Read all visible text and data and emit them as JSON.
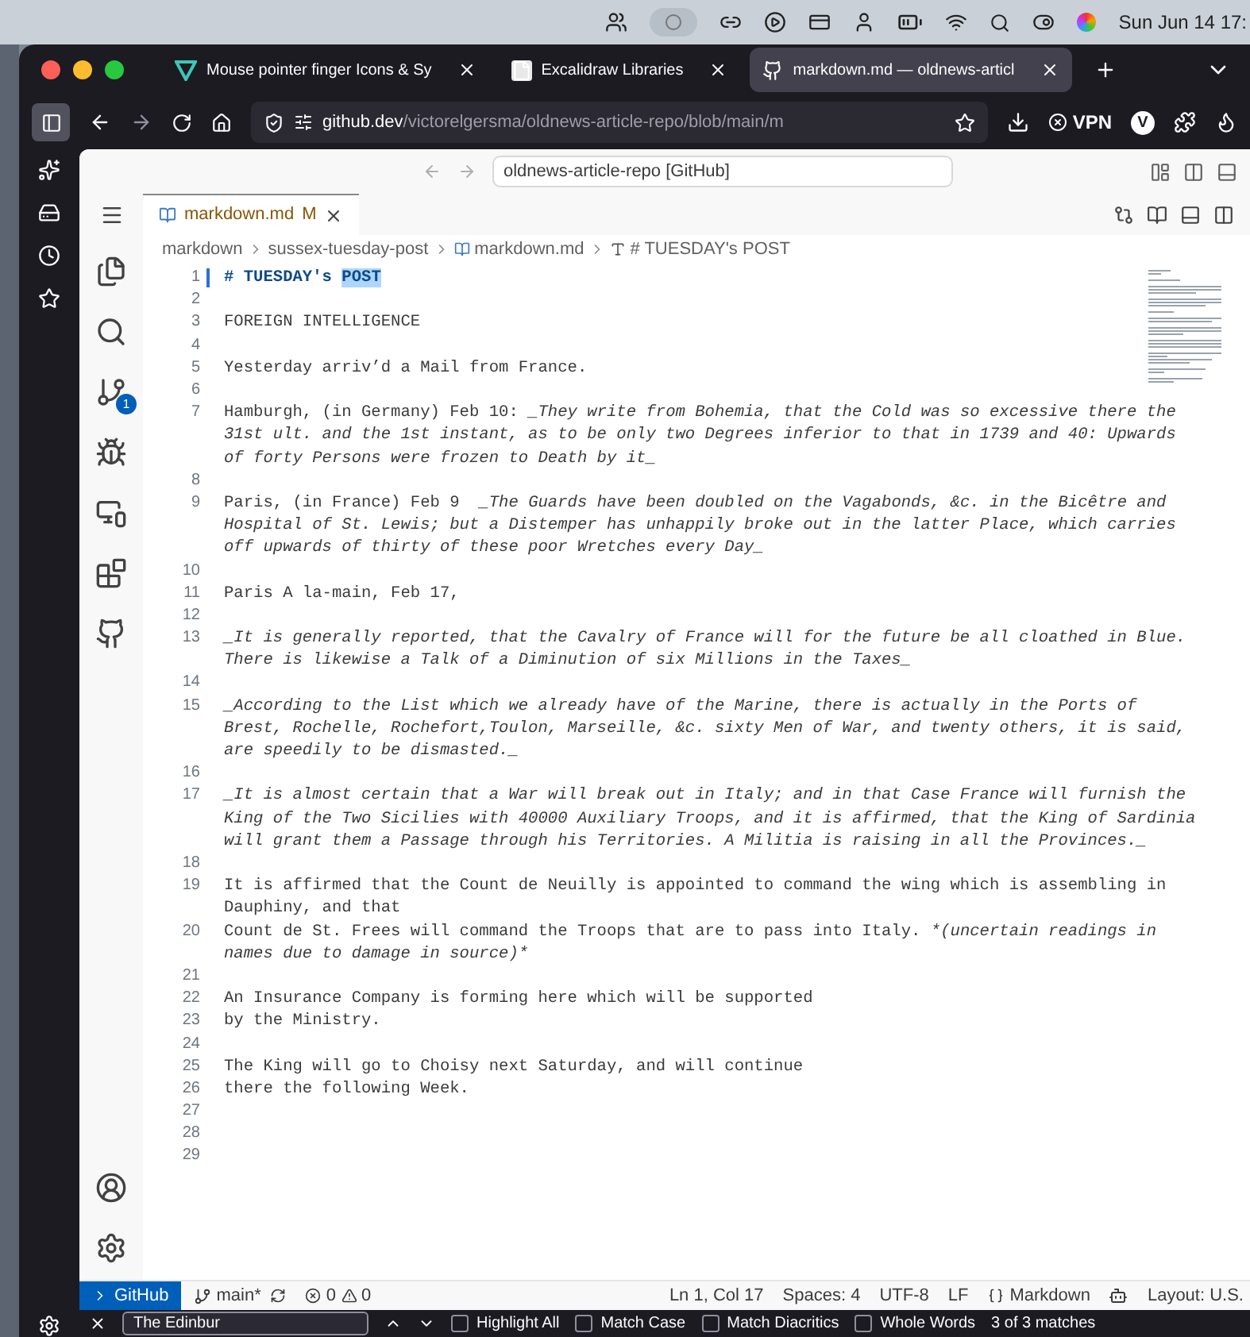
{
  "menu_bar": {
    "clock": "Sun Jun 14 17:"
  },
  "browser": {
    "tabs": [
      {
        "title": "Mouse pointer finger Icons & Sy",
        "selected": false,
        "kind": "vector"
      },
      {
        "title": "Excalidraw Libraries",
        "selected": false,
        "kind": "page"
      },
      {
        "title": "markdown.md — oldnews-articl",
        "selected": true,
        "kind": "github"
      }
    ],
    "url": {
      "host": "github.dev",
      "path": "/victorelgersma/oldnews-article-repo/blob/main/m"
    },
    "vpn": "VPN",
    "profile": "V"
  },
  "editor": {
    "command_center": "oldnews-article-repo [GitHub]",
    "source_control_badge": "1",
    "tab": {
      "name": "markdown.md",
      "status": "M",
      "selected": true
    },
    "breadcrumbs": [
      {
        "text": "markdown",
        "kind": "folder"
      },
      {
        "text": "sussex-tuesday-post",
        "kind": "folder"
      },
      {
        "text": "markdown.md",
        "kind": "file"
      },
      {
        "text": "# TUESDAY's POST",
        "kind": "symbol"
      }
    ],
    "lines": [
      {
        "number": "1",
        "changed": true,
        "rows": [
          [
            {
              "text": "# TUESDAY's ",
              "kind": "heading"
            },
            {
              "text": "POST",
              "kind": "heading-selected"
            }
          ]
        ]
      },
      {
        "number": "2",
        "changed": false
      },
      {
        "number": "3",
        "changed": false,
        "rows": [
          [
            {
              "text": "FOREIGN INTELLIGENCE",
              "kind": "plain"
            }
          ]
        ]
      },
      {
        "number": "4",
        "changed": false
      },
      {
        "number": "5",
        "changed": false,
        "rows": [
          [
            {
              "text": "Yesterday arriv’d a Mail from France.",
              "kind": "plain"
            }
          ]
        ]
      },
      {
        "number": "6",
        "changed": false
      },
      {
        "number": "7",
        "changed": false,
        "rows": [
          [
            {
              "text": "Hamburgh, (in Germany) Feb 10: ",
              "kind": "plain"
            },
            {
              "text": "_They write from Bohemia, that the Cold was so excessive there the",
              "kind": "italic"
            }
          ],
          [
            {
              "text": "31st ult. and the 1st instant, as to be only two Degrees inferior to that in 1739 and 40: Upwards",
              "kind": "italic"
            }
          ],
          [
            {
              "text": "of forty Persons were frozen to Death by it_",
              "kind": "italic"
            }
          ]
        ]
      },
      {
        "number": "8",
        "changed": false
      },
      {
        "number": "9",
        "changed": false,
        "rows": [
          [
            {
              "text": "Paris, (in France) Feb 9  ",
              "kind": "plain"
            },
            {
              "text": "_The Guards have been doubled on the Vagabonds, &c. in the Bicêtre and",
              "kind": "italic"
            }
          ],
          [
            {
              "text": "Hospital of St. Lewis; but a Distemper has unhappily broke out in the latter Place, which carries",
              "kind": "italic"
            }
          ],
          [
            {
              "text": "off upwards of thirty of these poor Wretches every Day_",
              "kind": "italic"
            }
          ]
        ]
      },
      {
        "number": "10",
        "changed": false
      },
      {
        "number": "11",
        "changed": false,
        "rows": [
          [
            {
              "text": "Paris A la-main, Feb 17,",
              "kind": "plain"
            }
          ]
        ]
      },
      {
        "number": "12",
        "changed": false
      },
      {
        "number": "13",
        "changed": false,
        "rows": [
          [
            {
              "text": "_It is generally reported, that the Cavalry of France will for the future be all cloathed in Blue.",
              "kind": "italic"
            }
          ],
          [
            {
              "text": "There is likewise a Talk of a Diminution of six Millions in the Taxes_",
              "kind": "italic"
            }
          ]
        ]
      },
      {
        "number": "14",
        "changed": false
      },
      {
        "number": "15",
        "changed": false,
        "rows": [
          [
            {
              "text": "_According to the List which we already have of the Marine, there is actually in the Ports of",
              "kind": "italic"
            }
          ],
          [
            {
              "text": "Brest, Rochelle, Rochefort,Toulon, Marseille, &c. sixty Men of War, and twenty others, it is said,",
              "kind": "italic"
            }
          ],
          [
            {
              "text": "are speedily to be dismasted._",
              "kind": "italic"
            }
          ]
        ]
      },
      {
        "number": "16",
        "changed": false
      },
      {
        "number": "17",
        "changed": false,
        "rows": [
          [
            {
              "text": "_It is almost certain that a War will break out in Italy; and in that Case France will furnish the",
              "kind": "italic"
            }
          ],
          [
            {
              "text": "King of the Two Sicilies with 40000 Auxiliary Troops, and it is affirmed, that the King of Sardinia",
              "kind": "italic"
            }
          ],
          [
            {
              "text": "will grant them a Passage through his Territories. A Militia is raising in all the Provinces._",
              "kind": "italic"
            }
          ]
        ]
      },
      {
        "number": "18",
        "changed": false
      },
      {
        "number": "19",
        "changed": false,
        "rows": [
          [
            {
              "text": "It is affirmed that the Count de Neuilly is appointed to command the wing which is assembling in",
              "kind": "plain"
            }
          ],
          [
            {
              "text": "Dauphiny, and that",
              "kind": "plain"
            }
          ]
        ]
      },
      {
        "number": "20",
        "changed": false,
        "rows": [
          [
            {
              "text": "Count de St. Frees will command the Troops that are to pass into Italy. ",
              "kind": "plain"
            },
            {
              "text": "*(uncertain readings in",
              "kind": "italic"
            }
          ],
          [
            {
              "text": "names due to damage in source)*",
              "kind": "italic"
            }
          ]
        ]
      },
      {
        "number": "21",
        "changed": false
      },
      {
        "number": "22",
        "changed": false,
        "rows": [
          [
            {
              "text": "An Insurance Company is forming here which will be supported",
              "kind": "plain"
            }
          ]
        ]
      },
      {
        "number": "23",
        "changed": false,
        "rows": [
          [
            {
              "text": "by the Ministry.",
              "kind": "plain"
            }
          ]
        ]
      },
      {
        "number": "24",
        "changed": false
      },
      {
        "number": "25",
        "changed": false,
        "rows": [
          [
            {
              "text": "The King will go to Choisy next Saturday, and will continue",
              "kind": "plain"
            }
          ]
        ]
      },
      {
        "number": "26",
        "changed": false,
        "rows": [
          [
            {
              "text": "there the following Week.",
              "kind": "plain"
            }
          ]
        ]
      },
      {
        "number": "27",
        "changed": false
      },
      {
        "number": "28",
        "changed": false
      },
      {
        "number": "29",
        "changed": false
      }
    ]
  },
  "status_bar": {
    "remote": "GitHub",
    "branch": "main*",
    "errors": "0",
    "warnings": "0",
    "items": [
      {
        "text": "Ln 1, Col 17",
        "kind": "plain"
      },
      {
        "text": "Spaces: 4",
        "kind": "plain"
      },
      {
        "text": "UTF-8",
        "kind": "plain"
      },
      {
        "text": "LF",
        "kind": "plain"
      },
      {
        "text": "Markdown",
        "kind": "language"
      },
      {
        "text": "Layout: U.S.",
        "kind": "plain"
      }
    ]
  },
  "find_bar": {
    "value": "The Edinbur",
    "options": [
      {
        "label": "Highlight All",
        "checked": false
      },
      {
        "label": "Match Case",
        "checked": false
      },
      {
        "label": "Match Diacritics",
        "checked": false
      },
      {
        "label": "Whole Words",
        "checked": false
      }
    ],
    "matches": "3 of 3 matches"
  }
}
